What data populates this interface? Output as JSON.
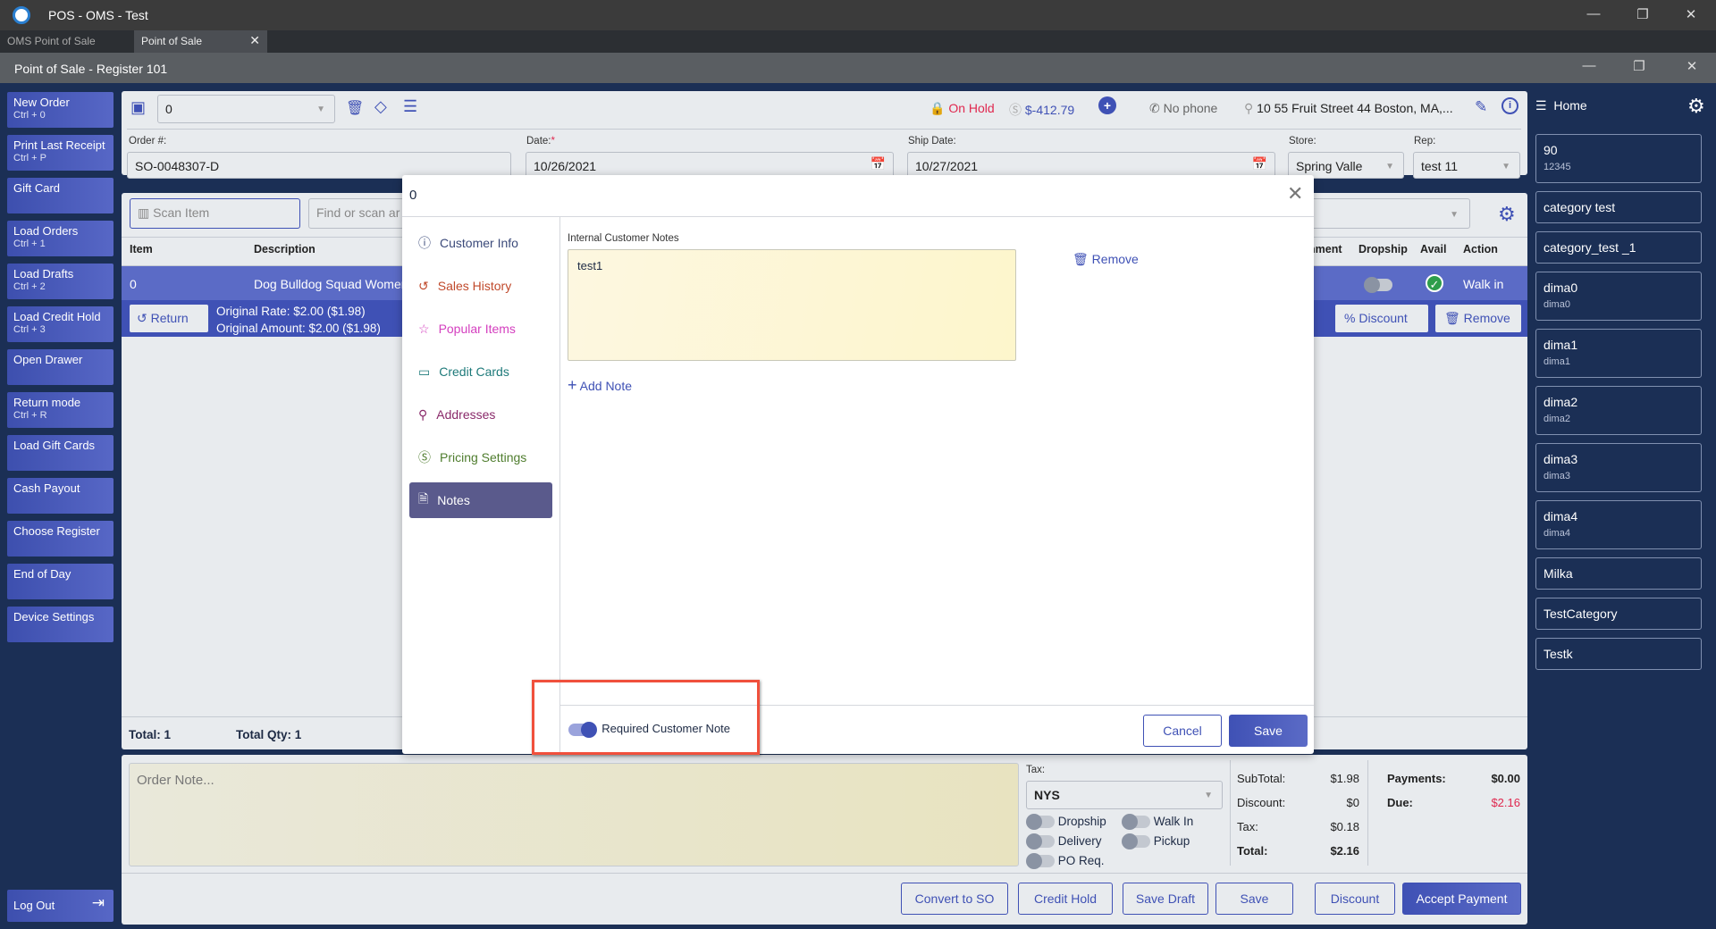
{
  "window": {
    "title": "POS - OMS - Test",
    "tabs": [
      "OMS Point of Sale",
      "Point of Sale"
    ],
    "register_title": "Point of Sale - Register 101"
  },
  "sidebar": {
    "buttons": [
      {
        "label": "New Order",
        "shortcut": "Ctrl + 0"
      },
      {
        "label": "Print Last Receipt",
        "shortcut": "Ctrl + P"
      },
      {
        "label": "Gift Card",
        "shortcut": ""
      },
      {
        "label": "Load Orders",
        "shortcut": "Ctrl + 1"
      },
      {
        "label": "Load Drafts",
        "shortcut": "Ctrl + 2"
      },
      {
        "label": "Load Credit Hold",
        "shortcut": "Ctrl + 3"
      },
      {
        "label": "Open Drawer",
        "shortcut": ""
      },
      {
        "label": "Return mode",
        "shortcut": "Ctrl + R"
      },
      {
        "label": "Load Gift Cards",
        "shortcut": ""
      },
      {
        "label": "Cash Payout",
        "shortcut": ""
      },
      {
        "label": "Choose Register",
        "shortcut": ""
      },
      {
        "label": "End of Day",
        "shortcut": ""
      },
      {
        "label": "Device Settings",
        "shortcut": ""
      }
    ],
    "logout": "Log Out"
  },
  "header": {
    "customer": "0",
    "status": "On Hold",
    "balance": "$-412.79",
    "phone": "No phone",
    "address": "10 55 Fruit Street 44 Boston, MA,...",
    "order_label": "Order #:",
    "order_no": "SO-0048307-D",
    "date_label": "Date:",
    "date": "10/26/2021",
    "ship_label": "Ship Date:",
    "ship_date": "10/27/2021",
    "store_label": "Store:",
    "store": "Spring Valle",
    "rep_label": "Rep:",
    "rep": "test 11"
  },
  "items": {
    "scan_placeholder": "Scan Item",
    "find_placeholder": "Find or scan ar",
    "columns": [
      "Item",
      "Description",
      "nment",
      "Dropship",
      "Avail",
      "Action"
    ],
    "row": {
      "item": "0",
      "description": "Dog Bulldog Squad Womer",
      "action": "Walk in"
    },
    "return_label": "Return",
    "original_rate": "Original Rate: $2.00 ($1.98)",
    "original_amount": "Original Amount: $2.00 ($1.98)",
    "discount_label": "Discount",
    "remove_label": "Remove",
    "total": "Total: 1",
    "total_qty": "Total Qty: 1"
  },
  "bottom": {
    "order_note_placeholder": "Order Note...",
    "tax_label": "Tax:",
    "tax": "NYS",
    "toggles": [
      "Dropship",
      "Walk In",
      "Delivery",
      "Pickup",
      "PO Req."
    ],
    "subtotal_label": "SubTotal:",
    "subtotal": "$1.98",
    "discount_label": "Discount:",
    "discount": "$0",
    "tax_amt_label": "Tax:",
    "tax_amt": "$0.18",
    "total_label": "Total:",
    "total": "$2.16",
    "payments_label": "Payments:",
    "payments": "$0.00",
    "due_label": "Due:",
    "due": "$2.16",
    "buttons": [
      "Convert to SO",
      "Credit Hold",
      "Save Draft",
      "Save",
      "Discount",
      "Accept Payment"
    ]
  },
  "right": {
    "home": "Home",
    "items": [
      {
        "title": "90",
        "sub": "12345"
      },
      {
        "title": "category test"
      },
      {
        "title": "category_test _1"
      },
      {
        "title": "dima0",
        "sub": "dima0"
      },
      {
        "title": "dima1",
        "sub": "dima1"
      },
      {
        "title": "dima2",
        "sub": "dima2"
      },
      {
        "title": "dima3",
        "sub": "dima3"
      },
      {
        "title": "dima4",
        "sub": "dima4"
      },
      {
        "title": "Milka"
      },
      {
        "title": "TestCategory"
      },
      {
        "title": "Testk"
      }
    ]
  },
  "modal": {
    "title": "0",
    "nav": [
      "Customer Info",
      "Sales History",
      "Popular Items",
      "Credit Cards",
      "Addresses",
      "Pricing Settings",
      "Notes"
    ],
    "notes_label": "Internal Customer Notes",
    "note_text": "test1",
    "remove": "Remove",
    "add_note": "Add Note",
    "required_toggle": "Required Customer Note",
    "required_on": true,
    "cancel": "Cancel",
    "save": "Save"
  },
  "colors": {
    "navy": "#1b2f55",
    "accent": "#3f51b5",
    "on_hold": "#e0284f"
  }
}
